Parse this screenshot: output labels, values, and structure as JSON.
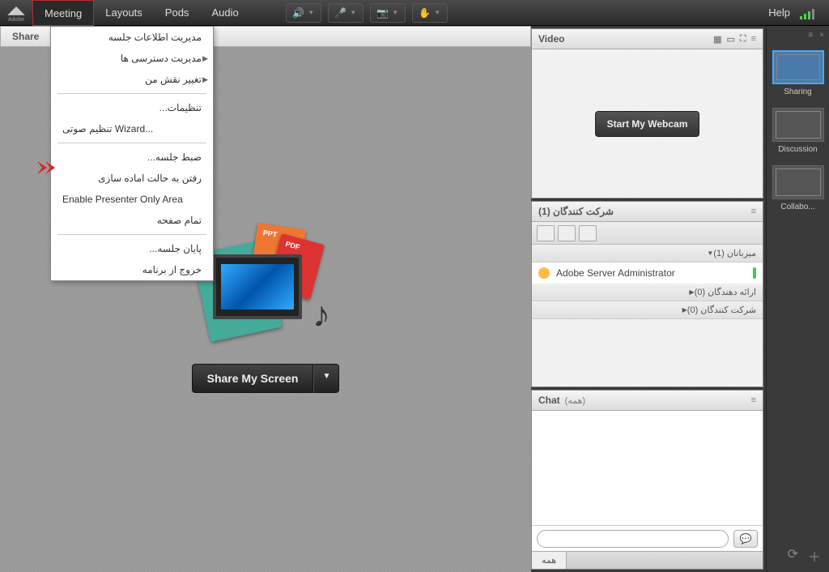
{
  "brand": "Adobe",
  "menu": {
    "meeting": "Meeting",
    "layouts": "Layouts",
    "pods": "Pods",
    "audio": "Audio",
    "help": "Help"
  },
  "meeting_dropdown": {
    "manage_info": "مدیریت اطلاعات جلسه",
    "manage_access": "مدیریت دسترسی ها",
    "change_role": "تغییر نقش من",
    "preferences": "تنظیمات...",
    "audio_wizard": "تنظیم صوتی Wizard...",
    "record": "ضبط جلسه...",
    "prepare_mode": "رفتن به حالت اماده سازی",
    "presenter_only": "Enable Presenter Only Area",
    "full_screen": "تمام صفحه",
    "end_meeting": "پایان جلسه...",
    "exit": "خروج از برنامه"
  },
  "share": {
    "title": "Share",
    "button": "Share My Screen"
  },
  "video": {
    "title": "Video",
    "button": "Start My Webcam"
  },
  "attendees": {
    "title": "شرکت کنندگان",
    "count": "(1)",
    "hosts": "میزبانان (1)",
    "presenters": "ارائه دهندگان (0)",
    "participants": "شرکت کنندگان (0)",
    "user": "Adobe Server Administrator"
  },
  "chat": {
    "title": "Chat",
    "sub": "(همه)",
    "tab": "همه"
  },
  "layouts_panel": {
    "sharing": "Sharing",
    "discussion": "Discussion",
    "collaboration": "Collabo..."
  }
}
